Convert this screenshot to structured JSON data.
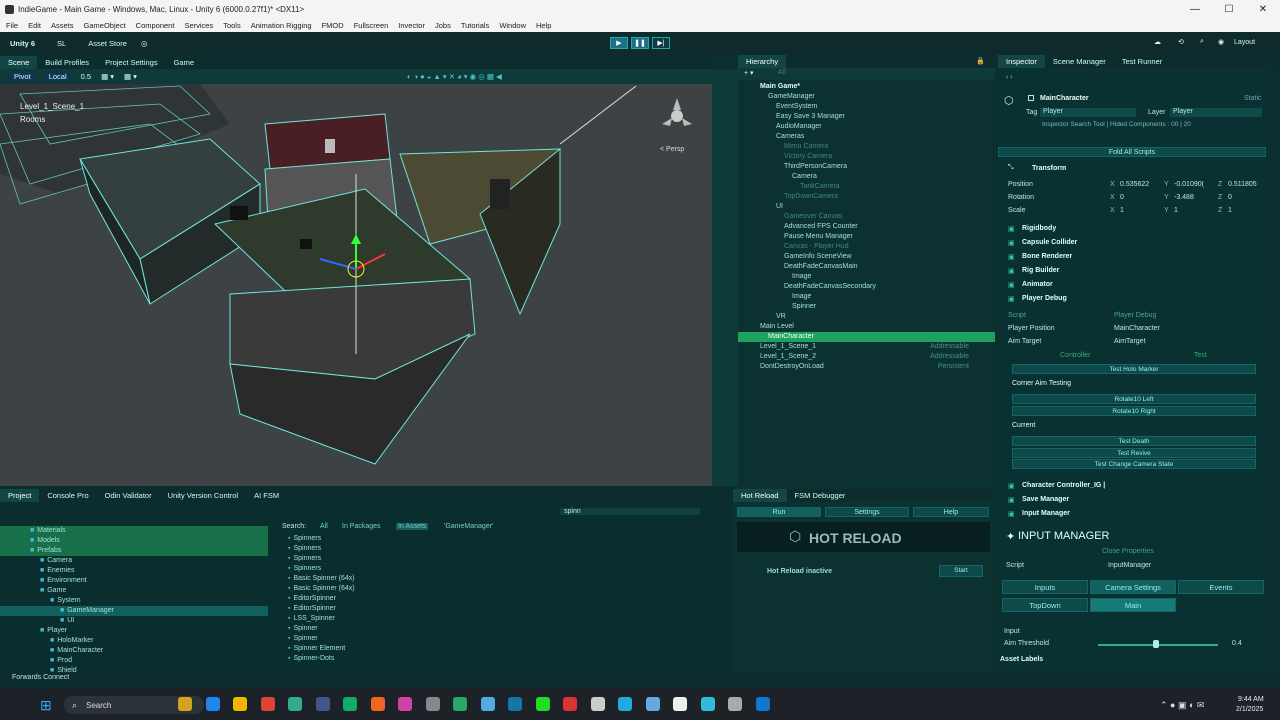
{
  "window": {
    "title": "IndieGame - Main Game - Windows, Mac, Linux - Unity 6 (6000.0.27f1)* <DX11>",
    "controls": [
      "—",
      "☐",
      "✕"
    ]
  },
  "menu": [
    "File",
    "Edit",
    "Assets",
    "GameObject",
    "Component",
    "Services",
    "Tools",
    "Animation Rigging",
    "FMOD",
    "Fullscreen",
    "Invector",
    "Jobs",
    "Tutorials",
    "Window",
    "Help"
  ],
  "toolbar": {
    "unity": "Unity 6",
    "account": "SL",
    "store": "Asset Store",
    "layout": "Layout"
  },
  "scene_tabs": [
    "Scene",
    "Build Profiles",
    "Project Settings",
    "Game"
  ],
  "scene_toolbar": {
    "pivot": "Pivot",
    "local": "Local",
    "snap": "0.5"
  },
  "scene_overlay": {
    "label1": "Level_1_Scene_1",
    "label2": "Rooms",
    "persp": "< Persp"
  },
  "hierarchy": {
    "tab": "Hierarchy",
    "search_placeholder": "All",
    "rows": [
      {
        "t": "Main Game*",
        "ind": 1,
        "bold": true
      },
      {
        "t": "GameManager",
        "ind": 2
      },
      {
        "t": "EventSystem",
        "ind": 3
      },
      {
        "t": "Easy Save 3 Manager",
        "ind": 3
      },
      {
        "t": "AudioManager",
        "ind": 3
      },
      {
        "t": "Cameras",
        "ind": 3
      },
      {
        "t": "Menu Camera",
        "ind": 4,
        "dim": true
      },
      {
        "t": "Victory Camera",
        "ind": 4,
        "dim": true
      },
      {
        "t": "ThirdPersonCamera",
        "ind": 4
      },
      {
        "t": "Camera",
        "ind": 5
      },
      {
        "t": "TankCamera",
        "ind": 6,
        "dim": true
      },
      {
        "t": "TopDownCamera",
        "ind": 4,
        "dim": true
      },
      {
        "t": "UI",
        "ind": 3
      },
      {
        "t": "Gameover Canvas",
        "ind": 4,
        "dim": true
      },
      {
        "t": "Advanced FPS Counter",
        "ind": 4
      },
      {
        "t": "Pause Menu Manager",
        "ind": 4
      },
      {
        "t": "Canvas - Player Hud",
        "ind": 4,
        "dim": true
      },
      {
        "t": "GameInfo SceneView",
        "ind": 4
      },
      {
        "t": "DeathFadeCanvasMain",
        "ind": 4
      },
      {
        "t": "Image",
        "ind": 5
      },
      {
        "t": "DeathFadeCanvasSecondary",
        "ind": 4
      },
      {
        "t": "Image",
        "ind": 5
      },
      {
        "t": "Spinner",
        "ind": 5
      },
      {
        "t": "VR",
        "ind": 3
      },
      {
        "t": "Main Level",
        "ind": 1
      },
      {
        "t": "MainCharacter",
        "ind": 2,
        "sel": true
      },
      {
        "t": "Level_1_Scene_1",
        "ind": 1,
        "right": "Addressable"
      },
      {
        "t": "Level_1_Scene_2",
        "ind": 1,
        "right": "Addressable"
      },
      {
        "t": "DontDestroyOnLoad",
        "ind": 1,
        "right": "Persistent"
      }
    ]
  },
  "inspector": {
    "tabs": [
      "Inspector",
      "Scene Manager",
      "Test Runner"
    ],
    "object": "MainCharacter",
    "static": "Static",
    "tag_label": "Tag",
    "tag": "Player",
    "layer_label": "Layer",
    "layer": "Player",
    "search": "Inspector Search Tool | Hided Components : 00 | 20",
    "fold": "Fold All Scripts",
    "transform": {
      "name": "Transform",
      "pos_label": "Position",
      "rot_label": "Rotation",
      "scale_label": "Scale",
      "px": "0.535622",
      "py": "-0.01090(",
      "pz": "0.511805",
      "rx": "0",
      "ry": "-3.488",
      "rz": "0",
      "sx": "1",
      "sy": "1",
      "sz": "1"
    },
    "components": [
      "Rigidbody",
      "Capsule Collider",
      "Bone Renderer",
      "Rig Builder",
      "Animator",
      "Player Debug"
    ],
    "script_label": "Script",
    "script": "Player Debug",
    "player_pos_label": "Player Position",
    "player_pos": "MainCharacter",
    "aim_label": "Aim Target",
    "aim": "AimTarget",
    "ctrl": "Controller",
    "test": "Test",
    "holo": "Test Holo Marker",
    "corner": "Corner Aim Testing",
    "rot_left": "Rotate10 Left",
    "rot_right": "Rotate10 Right",
    "current": "Current",
    "death": "Test Death",
    "revive": "Test Revive",
    "cam_state": "Test Change Camera State",
    "components2": [
      "Character Controller_IG |",
      "Save Manager",
      "Input Manager"
    ],
    "input_title": "INPUT MANAGER",
    "close_props": "Close Properties",
    "script2_label": "Script",
    "script2": "InputManager",
    "itabs": [
      "Inputs",
      "Camera Settings",
      "Events"
    ],
    "sub_tabs": [
      "TopDown",
      "Main"
    ],
    "input_label": "Input",
    "aim_thr_label": "Aim Threshold",
    "aim_thr": "0.4",
    "asset_labels": "Asset Labels"
  },
  "bottom": {
    "tabs": [
      "Project",
      "Console Pro",
      "Odin Validator",
      "Unity Version Control",
      "AI FSM"
    ],
    "search_text": "spinn",
    "search_label": "Search:",
    "filters": [
      "All",
      "In Packages",
      "In Assets",
      "'GameManager'"
    ],
    "tree": [
      {
        "t": "Materials",
        "ind": 1,
        "hl": true
      },
      {
        "t": "Models",
        "ind": 1,
        "hl": true
      },
      {
        "t": "Prefabs",
        "ind": 1,
        "hl": true
      },
      {
        "t": "Camera",
        "ind": 2
      },
      {
        "t": "Enemies",
        "ind": 2
      },
      {
        "t": "Environment",
        "ind": 2
      },
      {
        "t": "Game",
        "ind": 2
      },
      {
        "t": "System",
        "ind": 3
      },
      {
        "t": "GameManager",
        "ind": 4,
        "sel": true
      },
      {
        "t": "UI",
        "ind": 4
      },
      {
        "t": "Player",
        "ind": 2
      },
      {
        "t": "HoloMarker",
        "ind": 3
      },
      {
        "t": "MainCharacter",
        "ind": 3
      },
      {
        "t": "Prod",
        "ind": 3
      },
      {
        "t": "Shield",
        "ind": 3
      }
    ],
    "files": [
      "Spinners",
      "Spinners",
      "Spinners",
      "Spinners",
      "Basic Spinner (64x)",
      "Basic Spinner (64x)",
      "EditorSpinner",
      "EditorSpinner",
      "LSS_Spinner",
      "Spinner",
      "Spinner",
      "Spinner Element",
      "Spinner-Dots"
    ]
  },
  "hotreload": {
    "tabs": [
      "Hot Reload",
      "FSM Debugger"
    ],
    "run": "Run",
    "settings": "Settings",
    "help": "Help",
    "logo": "HOT RELOAD",
    "status": "Hot Reload inactive",
    "start": "Start"
  },
  "status": "Forwards Connect",
  "taskbar": {
    "search": "Search",
    "time": "9:44 AM",
    "date": "2/1/2025"
  }
}
